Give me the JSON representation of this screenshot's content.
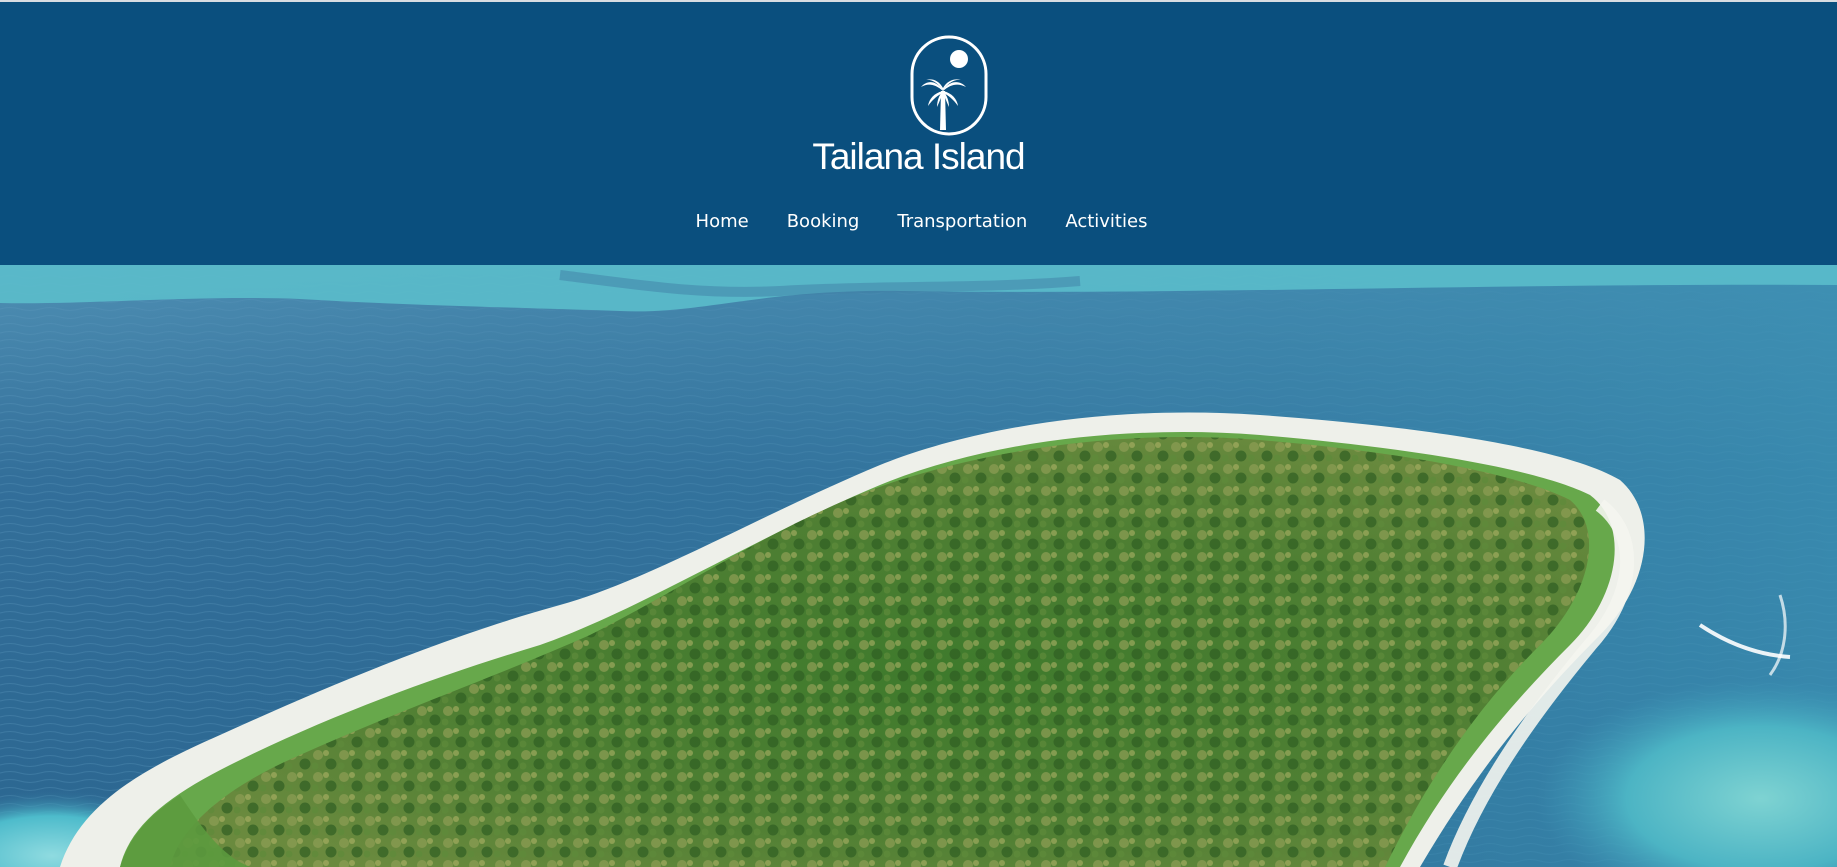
{
  "brand": {
    "name": "Tailana Island",
    "logo_icon": "palm-tree-sun-icon"
  },
  "nav": {
    "items": [
      {
        "label": "Home"
      },
      {
        "label": "Booking"
      },
      {
        "label": "Transportation"
      },
      {
        "label": "Activities"
      }
    ]
  },
  "hero": {
    "image": "aerial-tropical-island-photo"
  },
  "colors": {
    "header_bg": "#0a4f7e",
    "nav_text": "#ffffff",
    "ocean": "#2f6c97",
    "lagoon": "#5fc6cd",
    "foliage": "#3a6a2a",
    "sand": "#eef0ea"
  }
}
